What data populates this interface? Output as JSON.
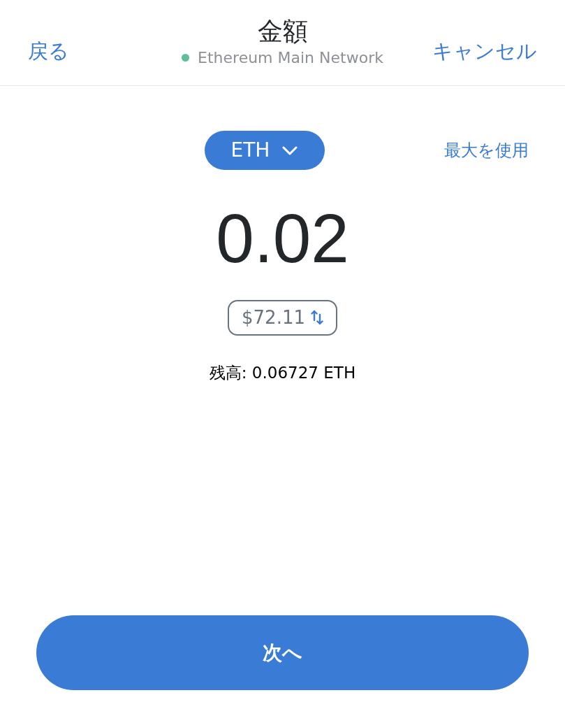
{
  "header": {
    "back": "戻る",
    "title": "金額",
    "network": "Ethereum Main Network",
    "cancel": "キャンセル"
  },
  "token": {
    "symbol": "ETH",
    "use_max": "最大を使用"
  },
  "amount": "0.02",
  "fiat": "$72.11",
  "balance": "残高: 0.06727 ETH",
  "next_button": "次へ"
}
